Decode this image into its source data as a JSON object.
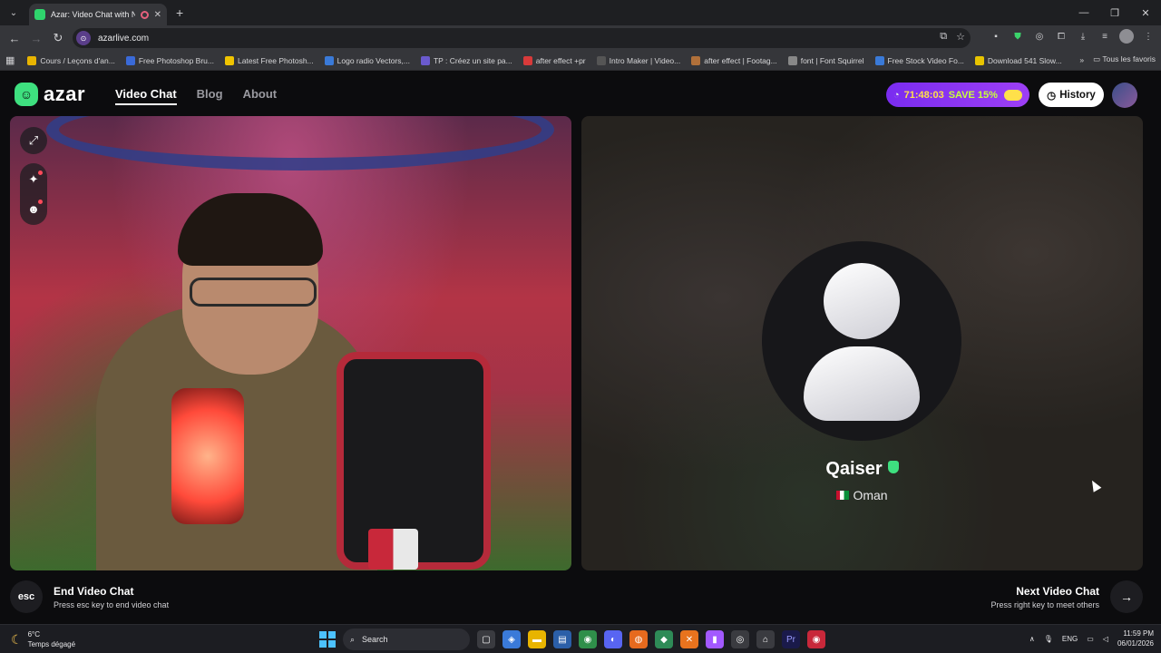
{
  "browser": {
    "tab_title": "Azar: Video Chat with New",
    "url": "azarlive.com",
    "bookmarks": [
      {
        "label": "Cours / Leçons d'an...",
        "color": "#e8b400"
      },
      {
        "label": "Free Photoshop Bru...",
        "color": "#3a6ad8"
      },
      {
        "label": "Latest Free Photosh...",
        "color": "#f0c400"
      },
      {
        "label": "Logo radio Vectors,...",
        "color": "#3a7ad8"
      },
      {
        "label": "TP : Créez un site pa...",
        "color": "#6a5acd"
      },
      {
        "label": "after effect +pr",
        "color": "#d83a3a"
      },
      {
        "label": "Intro Maker | Video...",
        "color": "#555555"
      },
      {
        "label": "after effect | Footag...",
        "color": "#b0703a"
      },
      {
        "label": "font | Font Squirrel",
        "color": "#888888"
      },
      {
        "label": "Free Stock Video Fo...",
        "color": "#3a7ad8"
      },
      {
        "label": "Download 541 Slow...",
        "color": "#e8c400"
      }
    ],
    "all_bookmarks": "Tous les favoris"
  },
  "nav": {
    "logo": "azar",
    "links": [
      "Video Chat",
      "Blog",
      "About"
    ],
    "timer": "71:48:03",
    "promo": "SAVE 15%",
    "history": "History"
  },
  "peer": {
    "name": "Qaiser",
    "country": "Oman"
  },
  "controls": {
    "esc_key": "esc",
    "end_title": "End Video Chat",
    "end_sub": "Press esc key to end video chat",
    "next_title": "Next Video Chat",
    "next_sub": "Press right key to meet others"
  },
  "taskbar": {
    "temp": "6°C",
    "weather": "Temps dégagé",
    "search": "Search",
    "lang": "ENG",
    "time": "11:59 PM",
    "date": "06/01/2026"
  },
  "colors": {
    "accent": "#3ee07f",
    "promo": "#7a2cf0"
  }
}
